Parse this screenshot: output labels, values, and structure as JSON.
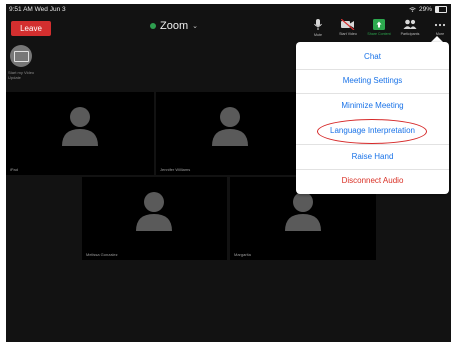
{
  "status_bar": {
    "time": "9:51 AM Wed Jun 3",
    "battery": "29%"
  },
  "toolbar_top": {
    "leave_label": "Leave",
    "app_title": "Zoom",
    "tools": [
      {
        "icon": "microphone-icon",
        "label": "Mute"
      },
      {
        "icon": "video-camera-icon",
        "label": "Start Video"
      },
      {
        "icon": "share-screen-icon",
        "label": "Share Content"
      },
      {
        "icon": "participants-icon",
        "label": "Participants"
      },
      {
        "icon": "more-icon",
        "label": "More"
      }
    ]
  },
  "self_view": {
    "caption": "Start my Video Update"
  },
  "participants": [
    {
      "name": "iPad"
    },
    {
      "name": "Jennifer Williams"
    },
    {
      "name": "Melissa Gonzalez"
    },
    {
      "name": "Margarita"
    }
  ],
  "more_menu": {
    "items": [
      {
        "label": "Chat"
      },
      {
        "label": "Meeting Settings"
      },
      {
        "label": "Minimize Meeting"
      },
      {
        "label": "Language Interpretation"
      },
      {
        "label": "Raise Hand"
      },
      {
        "label": "Disconnect Audio"
      }
    ]
  },
  "colors": {
    "leave": "#d32f2f",
    "menu_text": "#1a73e8",
    "danger": "#d93025",
    "highlight_circle": "#d62828",
    "share_green": "#2ca84e"
  }
}
